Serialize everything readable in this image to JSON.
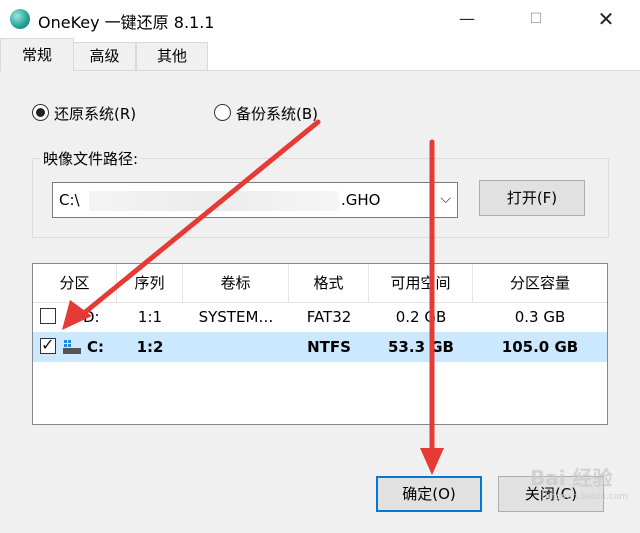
{
  "window": {
    "title": "OneKey 一键还原 8.1.1"
  },
  "tabs": [
    {
      "label": "常规",
      "active": true
    },
    {
      "label": "高级",
      "active": false
    },
    {
      "label": "其他",
      "active": false
    }
  ],
  "mode": {
    "restore_label": "还原系统(R)",
    "backup_label": "备份系统(B)",
    "selected": "restore"
  },
  "image_path": {
    "label": "映像文件路径:",
    "value_prefix": "C:\\",
    "value_suffix": ".GHO",
    "open_button": "打开(F)"
  },
  "partitions": {
    "headers": [
      "分区",
      "序列",
      "卷标",
      "格式",
      "可用空间",
      "分区容量"
    ],
    "rows": [
      {
        "checked": false,
        "drive": "D:",
        "seq": "1:1",
        "label": "SYSTEM…",
        "format": "FAT32",
        "free": "0.2 GB",
        "size": "0.3 GB",
        "selected": false
      },
      {
        "checked": true,
        "drive": "C:",
        "seq": "1:2",
        "label": "",
        "format": "NTFS",
        "free": "53.3 GB",
        "size": "105.0 GB",
        "selected": true
      }
    ]
  },
  "footer": {
    "ok_button": "确定(O)",
    "close_button": "关闭(C)"
  },
  "watermark": {
    "text": "Bai 经验",
    "sub": "jingyan.baidu.com"
  },
  "annotation_color": "#e63a35"
}
